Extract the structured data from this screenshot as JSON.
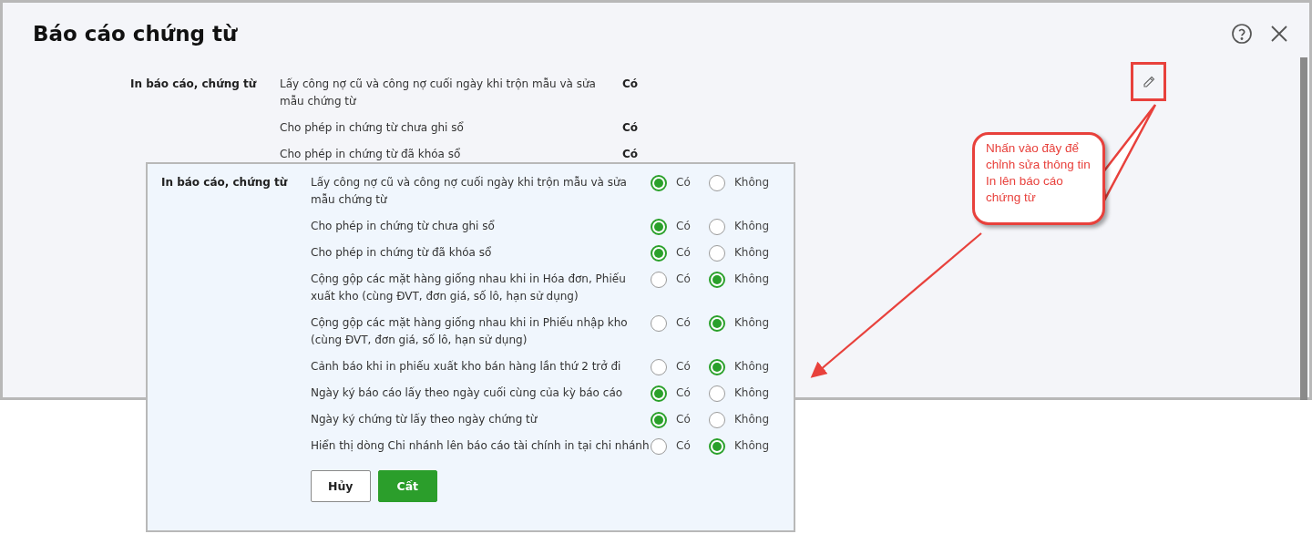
{
  "dialog": {
    "title": "Báo cáo chứng từ"
  },
  "settings": {
    "group_label": "In báo cáo, chứng từ",
    "items": [
      {
        "description": "Lấy công nợ cũ và công nợ cuối ngày khi trộn mẫu và sửa mẫu chứng từ",
        "value": "Có"
      },
      {
        "description": "Cho phép in chứng từ chưa ghi sổ",
        "value": "Có"
      },
      {
        "description": "Cho phép in chứng từ đã khóa sổ",
        "value": "Có"
      }
    ]
  },
  "edit_panel": {
    "group_label": "In báo cáo, chứng từ",
    "options": [
      {
        "description": "Lấy công nợ cũ và công nợ cuối ngày khi trộn mẫu và sửa mẫu chứng từ",
        "choices": [
          {
            "label": "Có",
            "selected": true
          },
          {
            "label": "Không",
            "selected": false
          }
        ]
      },
      {
        "description": "Cho phép in chứng từ chưa ghi sổ",
        "choices": [
          {
            "label": "Có",
            "selected": true
          },
          {
            "label": "Không",
            "selected": false
          }
        ]
      },
      {
        "description": "Cho phép in chứng từ đã khóa sổ",
        "choices": [
          {
            "label": "Có",
            "selected": true
          },
          {
            "label": "Không",
            "selected": false
          }
        ]
      },
      {
        "description": "Cộng gộp các mặt hàng giống nhau khi in Hóa đơn, Phiếu xuất kho (cùng ĐVT, đơn giá, số lô, hạn sử dụng)",
        "choices": [
          {
            "label": "Có",
            "selected": false
          },
          {
            "label": "Không",
            "selected": true
          }
        ]
      },
      {
        "description": "Cộng gộp các mặt hàng giống nhau khi in Phiếu nhập kho (cùng ĐVT, đơn giá, số lô, hạn sử dụng)",
        "choices": [
          {
            "label": "Có",
            "selected": false
          },
          {
            "label": "Không",
            "selected": true
          }
        ]
      },
      {
        "description": "Cảnh báo khi in phiếu xuất kho bán hàng lần thứ 2 trở đi",
        "choices": [
          {
            "label": "Có",
            "selected": false
          },
          {
            "label": "Không",
            "selected": true
          }
        ]
      },
      {
        "description": "Ngày ký báo cáo lấy theo ngày cuối cùng của kỳ báo cáo",
        "choices": [
          {
            "label": "Có",
            "selected": true
          },
          {
            "label": "Không",
            "selected": false
          }
        ]
      },
      {
        "description": "Ngày ký chứng từ lấy theo ngày chứng từ",
        "choices": [
          {
            "label": "Có",
            "selected": true
          },
          {
            "label": "Không",
            "selected": false
          }
        ]
      },
      {
        "description": "Hiển thị dòng Chi nhánh lên báo cáo tài chính in tại chi nhánh",
        "choices": [
          {
            "label": "Có",
            "selected": false
          },
          {
            "label": "Không",
            "selected": true
          }
        ]
      }
    ],
    "buttons": [
      {
        "label": "Hủy",
        "kind": "secondary"
      },
      {
        "label": "Cất",
        "kind": "primary"
      }
    ]
  },
  "callout": {
    "text": "Nhấn vào đây để chỉnh sửa thông tin In lên báo cáo chứng từ"
  }
}
